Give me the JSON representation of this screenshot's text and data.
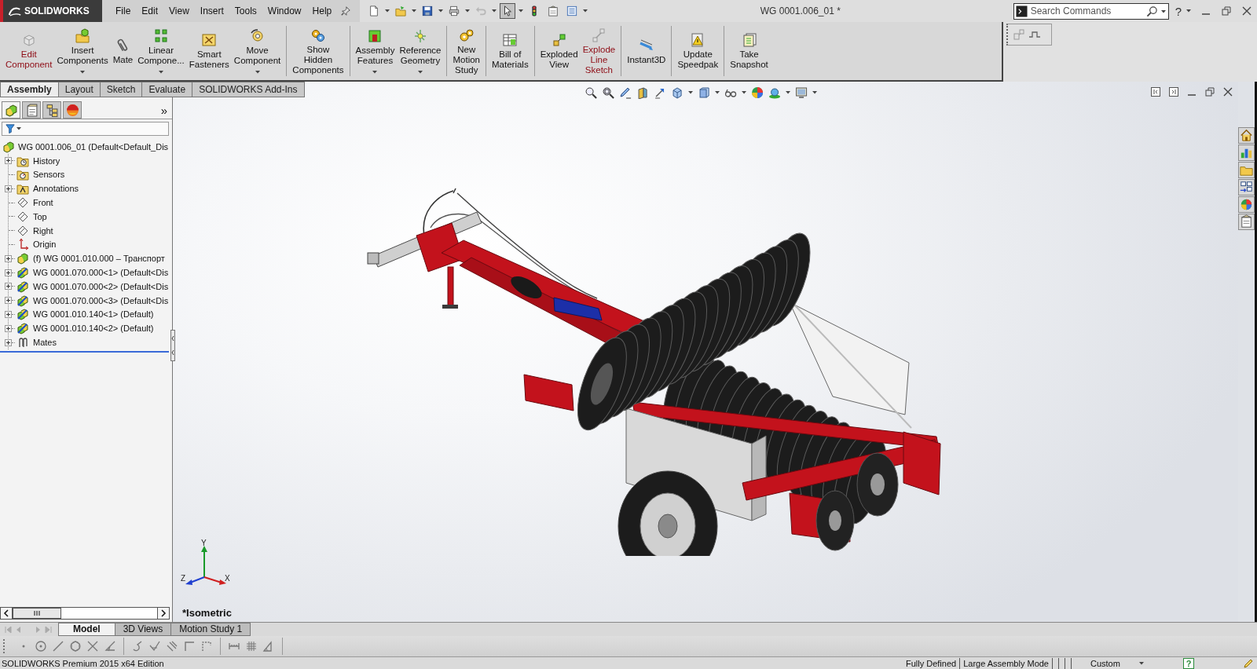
{
  "title_bar": {
    "product": "SOLIDWORKS",
    "document": "WG 0001.006_01 *",
    "help": "?"
  },
  "menu": [
    "File",
    "Edit",
    "View",
    "Insert",
    "Tools",
    "Window",
    "Help"
  ],
  "quick_access_tools": [
    {
      "pressed": false,
      "disabled": false
    },
    {
      "pressed": false,
      "disabled": false
    },
    {
      "pressed": false,
      "disabled": false
    },
    {
      "pressed": false,
      "disabled": false
    },
    {
      "pressed": false,
      "disabled": true
    },
    {
      "pressed": true,
      "disabled": false
    },
    {
      "pressed": false,
      "disabled": false
    },
    {
      "pressed": false,
      "disabled": false
    },
    {
      "pressed": false,
      "disabled": false
    }
  ],
  "search": {
    "placeholder": "Search Commands"
  },
  "command_manager": {
    "groups": [
      {
        "commands": [
          {
            "label": [
              "Edit",
              "Component"
            ],
            "highlighted": true,
            "dropdown": false
          },
          {
            "label": [
              "Insert",
              "Components"
            ],
            "highlighted": false,
            "dropdown": true
          },
          {
            "label": [
              "Mate"
            ],
            "highlighted": false,
            "dropdown": false
          },
          {
            "label": [
              "Linear",
              "Compone..."
            ],
            "highlighted": false,
            "dropdown": true
          },
          {
            "label": [
              "Smart",
              "Fasteners"
            ],
            "highlighted": false,
            "dropdown": false
          },
          {
            "label": [
              "Move",
              "Component"
            ],
            "highlighted": false,
            "dropdown": true
          }
        ]
      },
      {
        "commands": [
          {
            "label": [
              "Show",
              "Hidden",
              "Components"
            ],
            "highlighted": false,
            "dropdown": false
          }
        ]
      },
      {
        "commands": [
          {
            "label": [
              "Assembly",
              "Features"
            ],
            "highlighted": false,
            "dropdown": true
          },
          {
            "label": [
              "Reference",
              "Geometry"
            ],
            "highlighted": false,
            "dropdown": true
          }
        ]
      },
      {
        "commands": [
          {
            "label": [
              "New",
              "Motion",
              "Study"
            ],
            "highlighted": false,
            "dropdown": false
          }
        ]
      },
      {
        "commands": [
          {
            "label": [
              "Bill of",
              "Materials"
            ],
            "highlighted": false,
            "dropdown": false
          }
        ]
      },
      {
        "commands": [
          {
            "label": [
              "Exploded",
              "View"
            ],
            "highlighted": false,
            "dropdown": false
          },
          {
            "label": [
              "Explode",
              "Line",
              "Sketch"
            ],
            "highlighted": true,
            "dropdown": false
          }
        ]
      },
      {
        "commands": [
          {
            "label": [
              "Instant3D"
            ],
            "highlighted": false,
            "dropdown": false
          }
        ]
      },
      {
        "commands": [
          {
            "label": [
              "Update",
              "Speedpak"
            ],
            "highlighted": false,
            "dropdown": false
          }
        ]
      },
      {
        "commands": [
          {
            "label": [
              "Take",
              "Snapshot"
            ],
            "highlighted": false,
            "dropdown": false
          }
        ]
      }
    ]
  },
  "command_tabs": [
    {
      "label": "Assembly",
      "selected": true
    },
    {
      "label": "Layout",
      "selected": false
    },
    {
      "label": "Sketch",
      "selected": false
    },
    {
      "label": "Evaluate",
      "selected": false
    },
    {
      "label": "SOLIDWORKS Add-Ins",
      "selected": false
    }
  ],
  "feature_manager": {
    "tabs": [
      {
        "selected": true
      },
      {
        "selected": false
      },
      {
        "selected": false
      },
      {
        "selected": false
      }
    ],
    "more": "»",
    "tree": {
      "label": "WG 0001.006_01 (Default<Default_Dis",
      "kind": "assembly",
      "children": [
        {
          "label": "History",
          "kind": "history",
          "expandable": true
        },
        {
          "label": "Sensors",
          "kind": "sensors",
          "expandable": false
        },
        {
          "label": "Annotations",
          "kind": "annotations",
          "expandable": true
        },
        {
          "label": "Front",
          "kind": "plane",
          "expandable": false
        },
        {
          "label": "Top",
          "kind": "plane",
          "expandable": false
        },
        {
          "label": "Right",
          "kind": "plane",
          "expandable": false
        },
        {
          "label": "Origin",
          "kind": "origin",
          "expandable": false
        },
        {
          "label": "(f) WG 0001.010.000 – Транспорт",
          "kind": "assembly",
          "expandable": true
        },
        {
          "label": "WG 0001.070.000<1> (Default<Dis",
          "kind": "subassembly",
          "expandable": true
        },
        {
          "label": "WG 0001.070.000<2> (Default<Dis",
          "kind": "subassembly",
          "expandable": true
        },
        {
          "label": "WG 0001.070.000<3> (Default<Dis",
          "kind": "subassembly",
          "expandable": true
        },
        {
          "label": "WG 0001.010.140<1> (Default)",
          "kind": "subassembly",
          "expandable": true
        },
        {
          "label": "WG 0001.010.140<2> (Default)",
          "kind": "subassembly",
          "expandable": true
        },
        {
          "label": "Mates",
          "kind": "mates",
          "expandable": true
        }
      ]
    }
  },
  "viewport": {
    "triad": {
      "y": "Y",
      "x": "X",
      "z": "Z"
    },
    "view_name": "*Isometric"
  },
  "bottom_tabs": [
    {
      "label": "Model",
      "selected": true
    },
    {
      "label": "3D Views",
      "selected": false
    },
    {
      "label": "Motion Study 1",
      "selected": false
    }
  ],
  "status_bar": {
    "product": "SOLIDWORKS Premium 2015 x64 Edition",
    "state": "Fully Defined",
    "mode": "Large Assembly Mode",
    "units": "Custom",
    "help": "?"
  }
}
